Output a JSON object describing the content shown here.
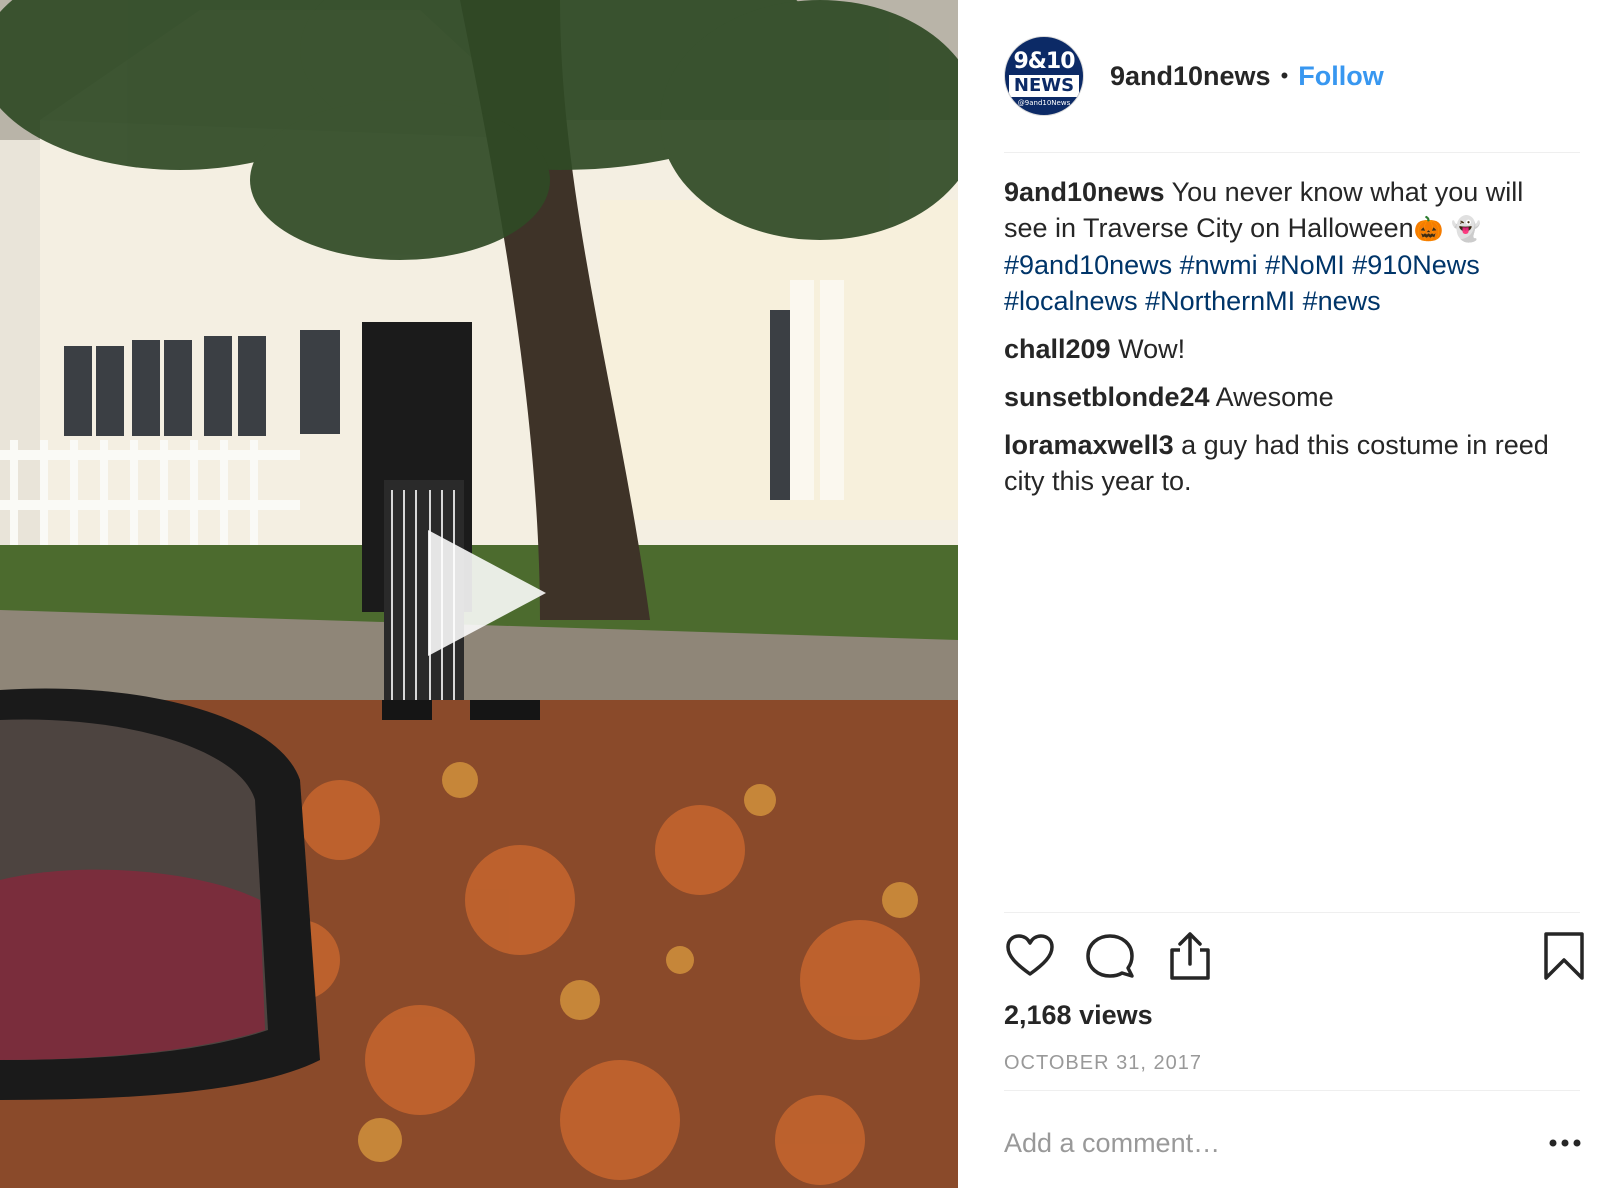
{
  "post": {
    "media_type": "video",
    "play_icon": "play-icon"
  },
  "header": {
    "avatar_text_top": "9&10",
    "avatar_text_mid": "NEWS",
    "avatar_text_sub": "@9and10News",
    "username": "9and10news",
    "separator": "•",
    "follow_label": "Follow"
  },
  "caption": {
    "username": "9and10news",
    "text": "You never know what you will see in Traverse City on Halloween",
    "emoji_1": "🎃",
    "emoji_2": "👻",
    "hashtags": "#9and10news #nwmi #NoMI #910News #localnews #NorthernMI #news"
  },
  "comments": [
    {
      "user": "chall209",
      "text": "Wow!"
    },
    {
      "user": "sunsetblonde24",
      "text": "Awesome"
    },
    {
      "user": "loramaxwell3",
      "text": "a guy had this costume in reed city this year to."
    }
  ],
  "actions": {
    "like_icon": "heart-icon",
    "comment_icon": "comment-bubble-icon",
    "share_icon": "share-icon",
    "save_icon": "bookmark-icon"
  },
  "views": "2,168 views",
  "date": "OCTOBER 31, 2017",
  "add_comment_placeholder": "Add a comment…",
  "more_icon": "more-options-icon",
  "colors": {
    "link_blue": "#3897f0",
    "hashtag_blue": "#003569",
    "text": "#262626",
    "muted": "#999999"
  }
}
